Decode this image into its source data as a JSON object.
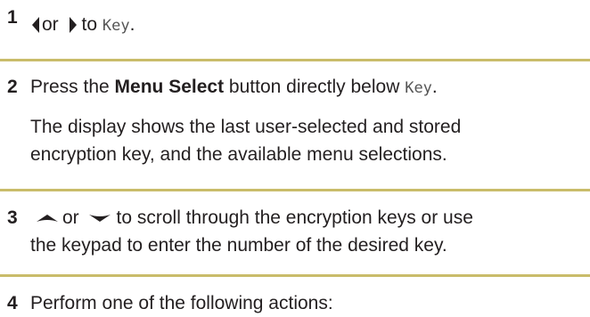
{
  "steps": [
    {
      "number": "1",
      "or_text": "or",
      "to_text": "to",
      "key_label": "Key",
      "end_punct": ".",
      "left_icon": "left-arrow-icon",
      "right_icon": "right-arrow-icon"
    },
    {
      "number": "2",
      "text_pre": "Press the ",
      "bold_text": "Menu Select",
      "text_mid": " button directly below ",
      "key_label": "Key",
      "end_punct": ".",
      "desc_line1": "The display shows the last user-selected and stored",
      "desc_line2": "encryption key, and the available menu selections."
    },
    {
      "number": "3",
      "or_text": "or",
      "line1_rest": "to scroll through the encryption keys or use",
      "line2": "the keypad to enter the number of the desired key.",
      "up_icon": "up-arrow-icon",
      "down_icon": "down-arrow-icon"
    },
    {
      "number": "4",
      "text": "Perform one of the following actions:"
    }
  ],
  "colors": {
    "text": "#231f20",
    "divider": "#c9bc6a",
    "mono_text": "#555555"
  }
}
